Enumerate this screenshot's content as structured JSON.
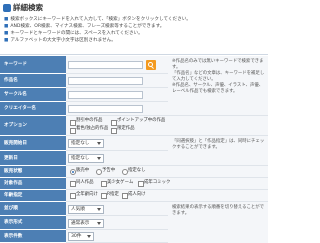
{
  "title": "詳細検索",
  "notes": [
    "検索ボックスにキーワードを入れて入力して、「検索」ボタンをクリックしてください。",
    "AND検索、OR検索、マイナス検索、フレーズ検索等することができます。",
    "キーワードとキーワードの間には、スペースを入れてください。",
    "アルファベットの大文字小文字は区別されません。"
  ],
  "rows": {
    "keyword": {
      "label": "キーワード"
    },
    "work_name": {
      "label": "作品名"
    },
    "circle_name": {
      "label": "サークル名"
    },
    "creator_name": {
      "label": "クリエイター名"
    },
    "options": {
      "label": "オプション"
    },
    "release_date": {
      "label": "販売開始日"
    },
    "update_date": {
      "label": "更新日"
    },
    "sales_status": {
      "label": "販売状態"
    },
    "target": {
      "label": "対象作品"
    },
    "age": {
      "label": "年齢指定"
    },
    "sort": {
      "label": "並び順"
    },
    "view": {
      "label": "表示形式"
    },
    "count": {
      "label": "表示件数"
    }
  },
  "side_notes": {
    "keyword": "※作品名のみでは無いキーワードで検索できます。\n「作品名」などの文章は、キーワードを補足して入力してください。\n※作品名、サークル、声優、イラスト、声優、レーベル作品でも検索できます。",
    "date": "「同選択肢」と「作品指定」は、同時にチェックすることができます。",
    "sort": "検索結果の表示する順番を切り替えることができます。"
  },
  "options_items": [
    "割引中の作品",
    "ポイントアップ中の作品",
    "着色/独占的作品",
    "限定作品"
  ],
  "release_date_value": "指定なし",
  "update_date_value": "指定なし",
  "sales_status_items": [
    "販売中",
    "予告中",
    "指定なし"
  ],
  "target_items": [
    "同人作品",
    "美少女ゲーム",
    "成年コミック"
  ],
  "age_items": [
    "全年齢向け",
    "R指定",
    "成人向け"
  ],
  "sort_value": "人気順",
  "view_value": "通常表示",
  "count_value": "30件"
}
